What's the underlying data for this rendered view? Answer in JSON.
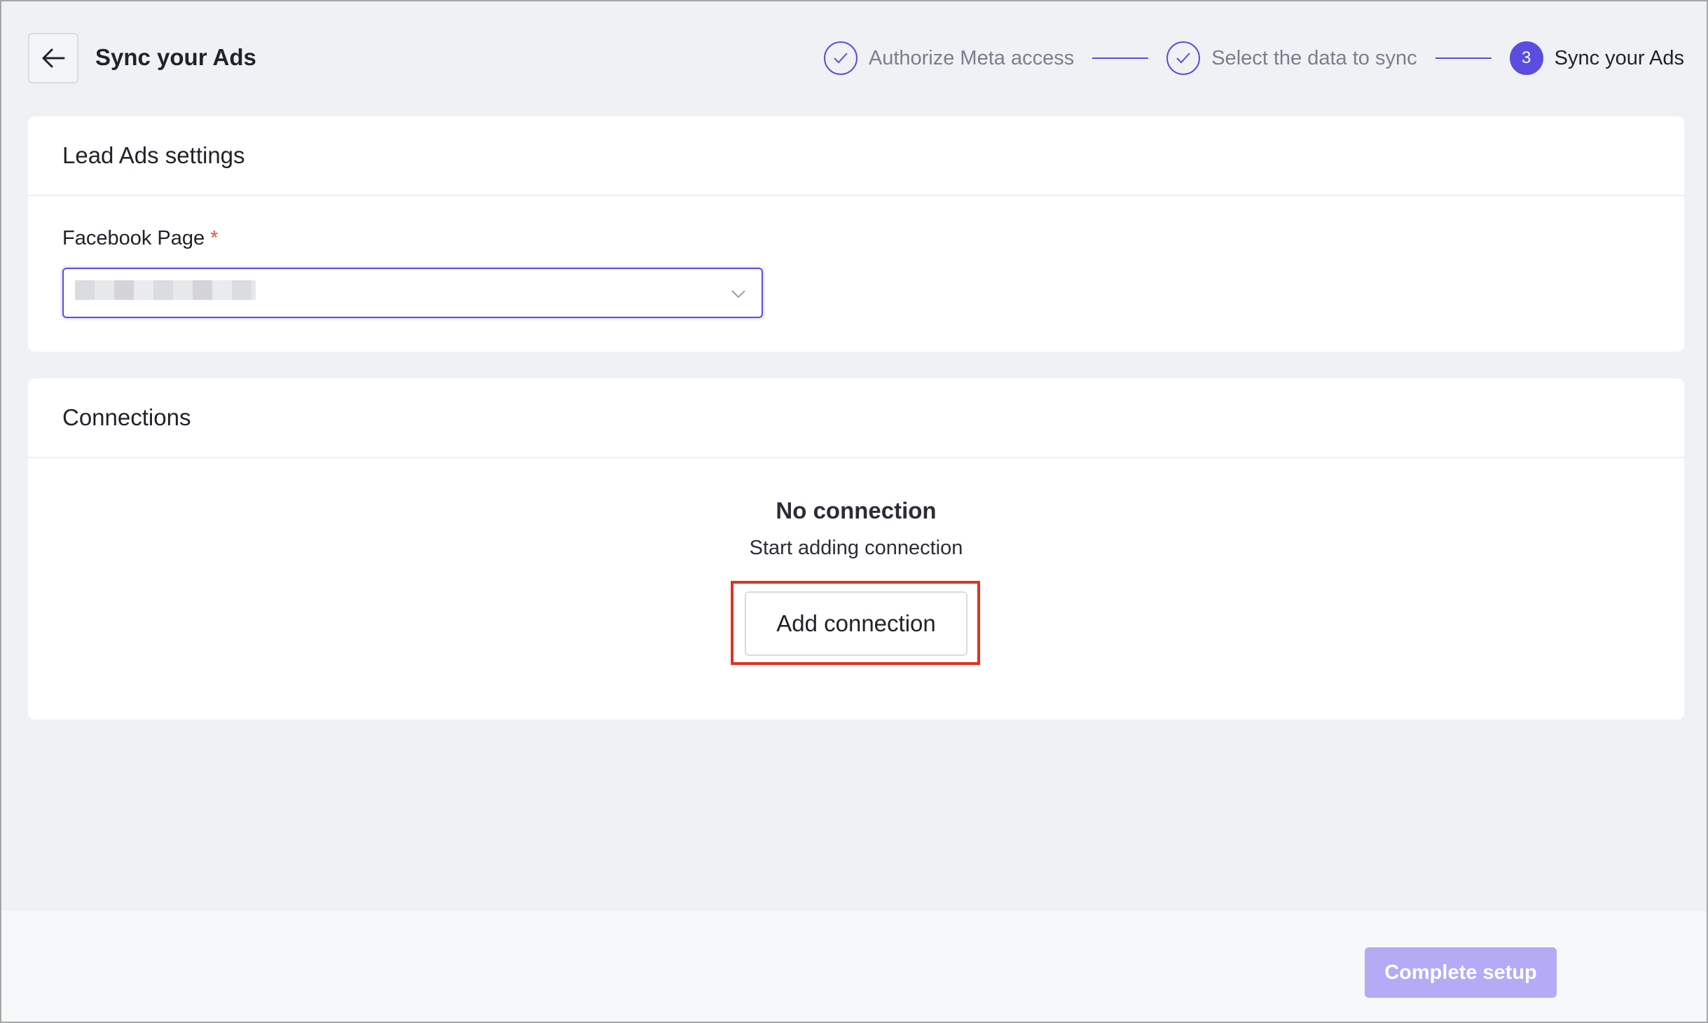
{
  "header": {
    "title": "Sync your Ads",
    "back_icon": "arrow-left-icon"
  },
  "stepper": {
    "steps": [
      {
        "label": "Authorize Meta access",
        "status": "completed"
      },
      {
        "label": "Select the data to sync",
        "status": "completed"
      },
      {
        "label": "Sync your Ads",
        "number": "3",
        "status": "active"
      }
    ]
  },
  "lead_ads": {
    "title": "Lead Ads settings",
    "facebook_page_label": "Facebook Page",
    "required_mark": "*"
  },
  "connections": {
    "title": "Connections",
    "empty_title": "No connection",
    "empty_subtitle": "Start adding connection",
    "add_button_label": "Add connection"
  },
  "footer": {
    "complete_label": "Complete setup"
  },
  "colors": {
    "accent": "#5b4de0",
    "required": "#e8542f",
    "highlight": "#e0331f",
    "complete_disabled": "#b3abf6"
  }
}
